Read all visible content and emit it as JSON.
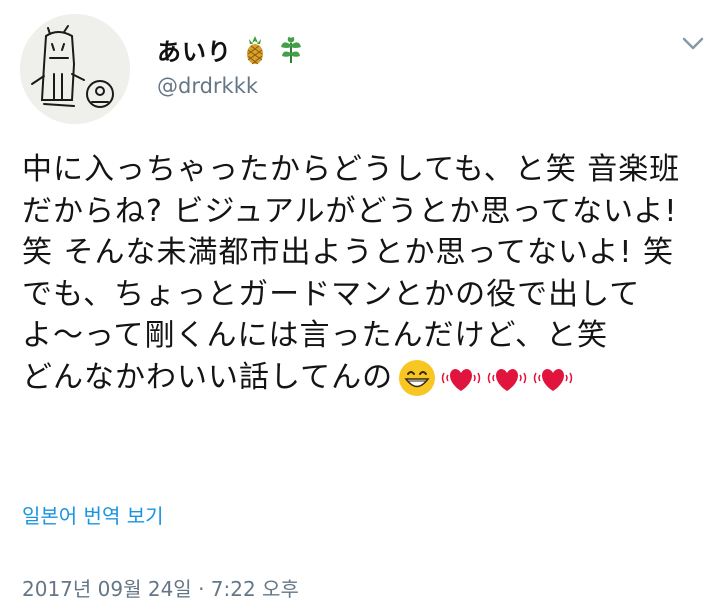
{
  "user": {
    "display_name": "あいり",
    "handle": "@drdrkkk",
    "name_emojis": [
      "pineapple-icon",
      "herb-icon"
    ]
  },
  "tweet": {
    "text": "中に入っちゃったからどうしても、と笑 音楽班だからね? ビジュアルがどうとか思ってないよ! 笑 そんな未満都市出ようとか思ってないよ! 笑でも、ちょっとガードマンとかの役で出してよ〜って剛くんには言ったんだけど、と笑\nどんなかわいい話してんの",
    "trailing_emojis": [
      "grinning-face-icon",
      "beating-heart-icon",
      "beating-heart-icon",
      "beating-heart-icon"
    ]
  },
  "translate_link": "일본어 번역 보기",
  "timestamp": "2017년 09월 24일 · 7:22 오후",
  "colors": {
    "link": "#1b95e0",
    "secondary_text": "#657786",
    "heart": "#e0143c"
  }
}
